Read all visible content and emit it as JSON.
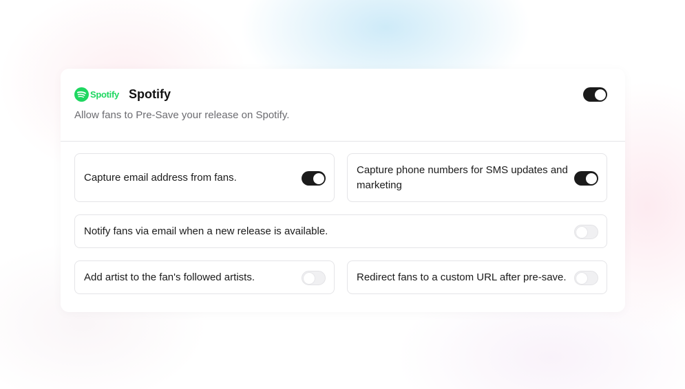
{
  "integration": {
    "logo_text": "Spotify",
    "title": "Spotify",
    "description": "Allow fans to Pre-Save your release on Spotify.",
    "enabled": true
  },
  "options": {
    "capture_email": {
      "label": "Capture email address from fans.",
      "enabled": true
    },
    "capture_phone": {
      "label": "Capture phone numbers for SMS updates and marketing",
      "enabled": true
    },
    "notify_email": {
      "label": "Notify fans via email when a new release is available.",
      "enabled": false
    },
    "follow_artist": {
      "label": "Add artist to the fan's followed artists.",
      "enabled": false
    },
    "redirect_url": {
      "label": "Redirect fans to a custom URL after pre-save.",
      "enabled": false
    }
  },
  "colors": {
    "spotify_green": "#1ed760",
    "toggle_on": "#1b1b1b",
    "toggle_off": "#f0f0f2"
  },
  "icons": {
    "logo": "spotify-logo-icon"
  }
}
